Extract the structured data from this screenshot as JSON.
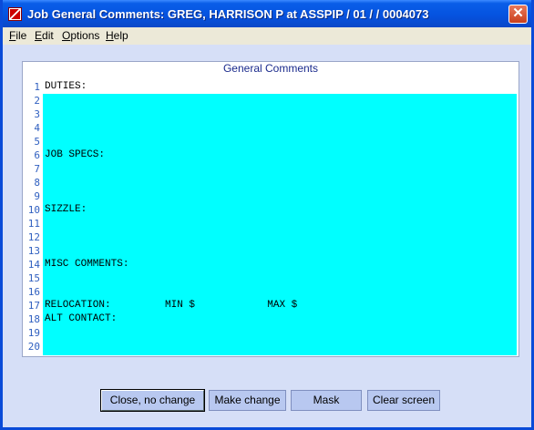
{
  "window": {
    "title": "Job General Comments:  GREG, HARRISON P at  ASSPIP   / 01 /   / 0004073",
    "close_symbol": "✕"
  },
  "menu": [
    {
      "key": "F",
      "rest": "ile"
    },
    {
      "key": "E",
      "rest": "dit"
    },
    {
      "key": "O",
      "rest": "ptions"
    },
    {
      "key": "H",
      "rest": "elp"
    }
  ],
  "panel": {
    "header": "General Comments"
  },
  "lines": [
    {
      "n": "1",
      "text": "DUTIES:"
    },
    {
      "n": "2",
      "text": ""
    },
    {
      "n": "3",
      "text": ""
    },
    {
      "n": "4",
      "text": ""
    },
    {
      "n": "5",
      "text": ""
    },
    {
      "n": "6",
      "text": "JOB SPECS:"
    },
    {
      "n": "7",
      "text": ""
    },
    {
      "n": "8",
      "text": ""
    },
    {
      "n": "9",
      "text": ""
    },
    {
      "n": "10",
      "text": "SIZZLE:"
    },
    {
      "n": "11",
      "text": ""
    },
    {
      "n": "12",
      "text": ""
    },
    {
      "n": "13",
      "text": ""
    },
    {
      "n": "14",
      "text": "MISC COMMENTS:"
    },
    {
      "n": "15",
      "text": ""
    },
    {
      "n": "16",
      "text": ""
    },
    {
      "n": "17",
      "text": "RELOCATION:         MIN $            MAX $"
    },
    {
      "n": "18",
      "text": "ALT CONTACT:"
    },
    {
      "n": "19",
      "text": ""
    },
    {
      "n": "20",
      "text": ""
    }
  ],
  "buttons": {
    "close_no_change": "Close, no change",
    "make_change": "Make change",
    "mask": "Mask",
    "clear_screen": "Clear screen"
  },
  "colors": {
    "editor_bg": "#00ffff",
    "title_bar": "#0553e0",
    "window_bg": "#d6dff7",
    "button_bg": "#b8c8f0"
  }
}
